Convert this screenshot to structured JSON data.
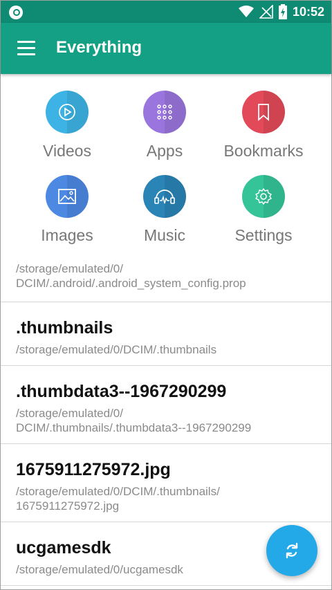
{
  "status_bar": {
    "time": "10:52"
  },
  "app_bar": {
    "title": "Everything"
  },
  "categories": [
    {
      "label": "Videos",
      "icon": "play-icon",
      "color": "#3db2e4"
    },
    {
      "label": "Apps",
      "icon": "apps-grid-icon",
      "color": "#9a75dd"
    },
    {
      "label": "Bookmarks",
      "icon": "bookmark-icon",
      "color": "#e24a5a"
    },
    {
      "label": "Images",
      "icon": "image-icon",
      "color": "#4d88e3"
    },
    {
      "label": "Music",
      "icon": "music-wave-icon",
      "color": "#2a84b5"
    },
    {
      "label": "Settings",
      "icon": "gear-icon",
      "color": "#35c497"
    }
  ],
  "files": [
    {
      "name": "",
      "path": "/storage/emulated/0/\nDCIM/.android/.android_system_config.prop"
    },
    {
      "name": ".thumbnails",
      "path": "/storage/emulated/0/DCIM/.thumbnails"
    },
    {
      "name": ".thumbdata3--1967290299",
      "path": "/storage/emulated/0/\nDCIM/.thumbnails/.thumbdata3--1967290299"
    },
    {
      "name": "1675911275972.jpg",
      "path": "/storage/emulated/0/DCIM/.thumbnails/\n1675911275972.jpg"
    },
    {
      "name": "ucgamesdk",
      "path": "/storage/emulated/0/ucgamesdk"
    }
  ],
  "fab": {
    "icon": "refresh-icon",
    "color": "#23a8e8"
  }
}
